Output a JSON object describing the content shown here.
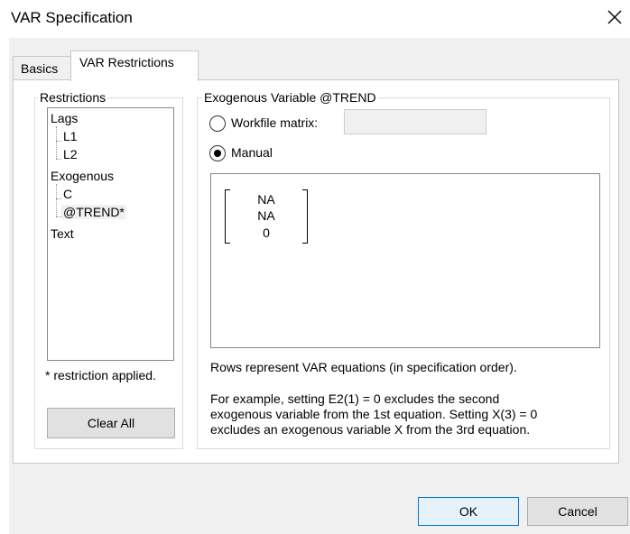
{
  "window": {
    "title": "VAR Specification",
    "close_icon": "close-icon"
  },
  "tabs": [
    {
      "label": "Basics",
      "selected": false
    },
    {
      "label": "VAR Restrictions",
      "selected": true
    }
  ],
  "restrictions": {
    "group_label": "Restrictions",
    "tree": [
      {
        "label": "Lags"
      },
      {
        "label": "L1"
      },
      {
        "label": "L2"
      },
      {
        "label": "Exogenous"
      },
      {
        "label": "C"
      },
      {
        "label": "@TREND*",
        "selected": true
      },
      {
        "label": "Text"
      }
    ],
    "note": "* restriction applied.",
    "clear_button": "Clear All"
  },
  "exogenous": {
    "group_label": "Exogenous Variable @TREND",
    "workfile_matrix_label": "Workfile matrix:",
    "workfile_matrix_value": "",
    "manual_label": "Manual",
    "selected_option": "Manual",
    "matrix_values": [
      "NA",
      "NA",
      "0"
    ],
    "info_line1": "Rows represent VAR equations (in specification order).",
    "info_line2": "For example, setting E2(1) = 0 excludes the second",
    "info_line3": "exogenous variable from the 1st equation. Setting X(3) = 0",
    "info_line4": "excludes an exogenous variable X from the 3rd equation."
  },
  "buttons": {
    "ok": "OK",
    "cancel": "Cancel"
  }
}
